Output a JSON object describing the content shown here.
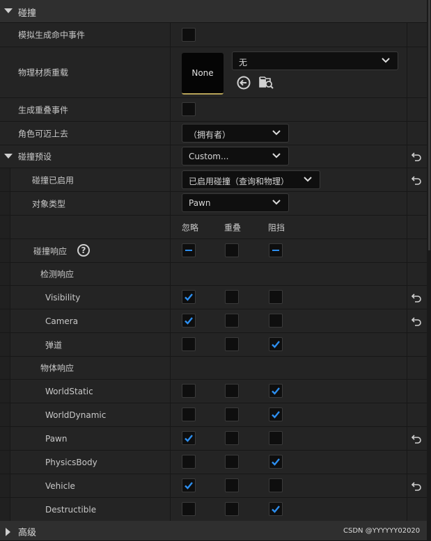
{
  "sections": {
    "collision": {
      "label": "碰撞"
    },
    "advanced": {
      "label": "高级"
    }
  },
  "props": {
    "simulate_hit": {
      "label": "模拟生成命中事件"
    },
    "phys_material": {
      "label": "物理材质重载",
      "thumb_text": "None",
      "combo_value": "无",
      "icon1": "back-arrow-circle-icon",
      "icon2": "browse-folder-search-icon"
    },
    "gen_overlap": {
      "label": "生成重叠事件"
    },
    "can_step_up": {
      "label": "角色可迈上去",
      "combo_value": "（拥有者）"
    },
    "presets": {
      "label": "碰撞预设",
      "combo_value": "Custom..."
    },
    "collision_enabled": {
      "label": "碰撞已启用",
      "combo_value": "已启用碰撞（查询和物理）"
    },
    "object_type": {
      "label": "对象类型",
      "combo_value": "Pawn"
    }
  },
  "response_headers": {
    "ignore": "忽略",
    "overlap": "重叠",
    "block": "阻挡"
  },
  "collision_responses": {
    "label": "碰撞响应",
    "help": "?"
  },
  "trace_responses": {
    "label": "检测响应"
  },
  "object_responses": {
    "label": "物体响应"
  },
  "channels": [
    {
      "name": "Visibility",
      "state": "ignore",
      "reset": true
    },
    {
      "name": "Camera",
      "state": "ignore",
      "reset": true
    },
    {
      "name": "弹道",
      "state": "block",
      "reset": false
    },
    {
      "name": "WorldStatic",
      "state": "block",
      "reset": false
    },
    {
      "name": "WorldDynamic",
      "state": "block",
      "reset": false
    },
    {
      "name": "Pawn",
      "state": "ignore",
      "reset": true
    },
    {
      "name": "PhysicsBody",
      "state": "block",
      "reset": false
    },
    {
      "name": "Vehicle",
      "state": "ignore",
      "reset": true
    },
    {
      "name": "Destructible",
      "state": "block",
      "reset": false
    }
  ],
  "watermark": "CSDN @YYYYYY02020",
  "colors": {
    "accent": "#2d8ff0",
    "row_bg": "#242424",
    "header_bg": "#2f2f2f"
  }
}
